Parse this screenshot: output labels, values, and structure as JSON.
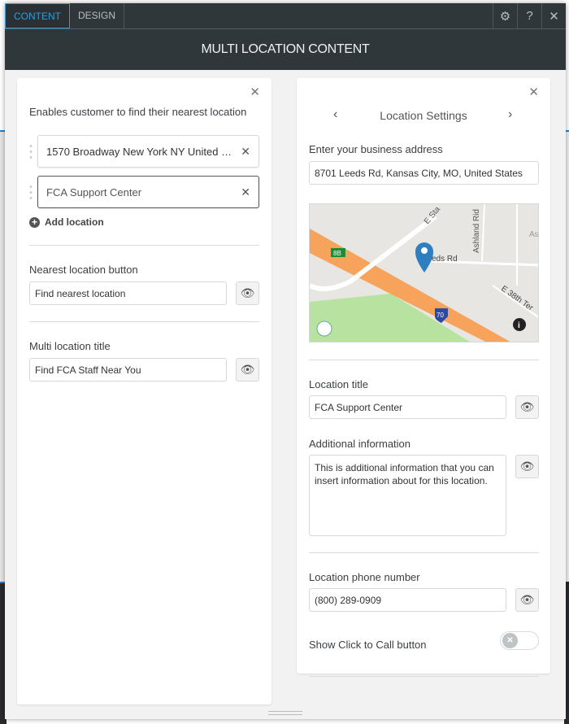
{
  "tabs": [
    {
      "label": "CONTENT",
      "active": true
    },
    {
      "label": "DESIGN",
      "active": false
    }
  ],
  "toolbar": {
    "settings": "gear-icon",
    "help": "?",
    "close": "close-icon"
  },
  "title": "MULTI LOCATION CONTENT",
  "left": {
    "description": "Enables customer to find their nearest location",
    "locations": [
      "1570 Broadway New York NY United S...",
      "FCA Support Center"
    ],
    "add_location": "Add location",
    "nearest_label": "Nearest location button",
    "nearest_value": "Find nearest location",
    "multi_title_label": "Multi location title",
    "multi_title_value": "Find FCA Staff Near You"
  },
  "right": {
    "nav_title": "Location Settings",
    "prev": "‹",
    "next": "›",
    "address_label": "Enter your business address",
    "address_value": "8701 Leeds Rd, Kansas City, MO, United States",
    "map": {
      "labels": [
        "E Sta",
        "Ashland Rid",
        "As",
        "eds Rd",
        "8B",
        "70",
        "E 38th Ter"
      ]
    },
    "loc_title_label": "Location title",
    "loc_title_value": "FCA Support Center",
    "info_label": "Additional information",
    "info_value": "This is additional information that you can insert information about for this location.",
    "phone_label": "Location phone number",
    "phone_value": "(800) 289-0909",
    "call_label": "Show Click to Call button",
    "call_enabled": false
  },
  "colors": {
    "accent": "#2d9ed8",
    "header": "#30373b",
    "pin": "#2f7fc0"
  }
}
